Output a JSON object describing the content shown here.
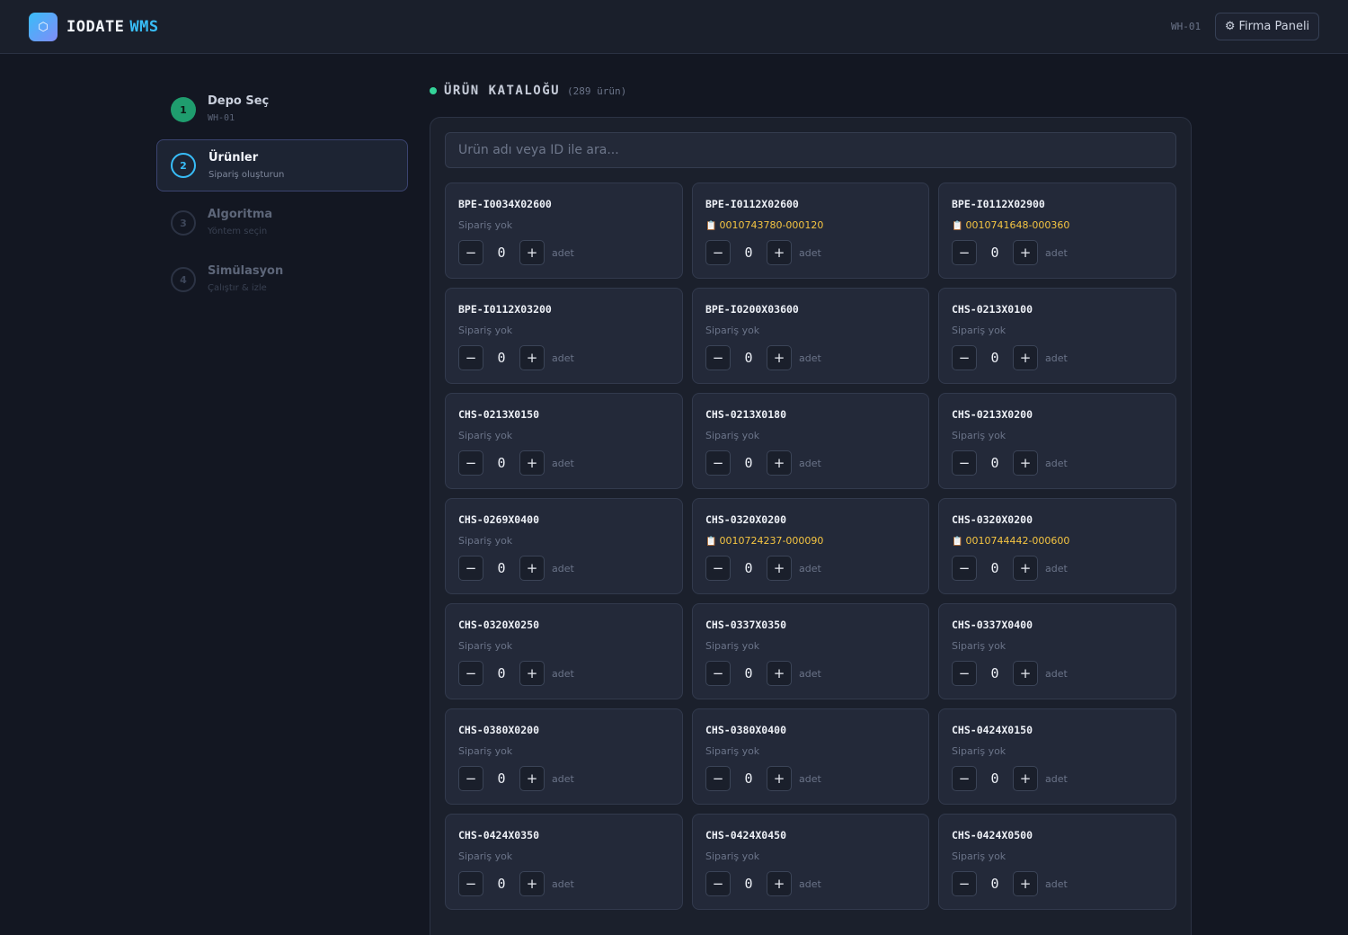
{
  "header": {
    "logo_icon": "hexagon-icon",
    "brand_primary": "IODATE",
    "brand_secondary": "WMS",
    "warehouse_code": "WH-01",
    "firma_button": "Firma Paneli",
    "firma_icon": "gear-icon"
  },
  "steps": [
    {
      "number": "1",
      "title": "Depo Seç",
      "subtitle": "WH-01",
      "state": "done"
    },
    {
      "number": "2",
      "title": "Ürünler",
      "subtitle": "Sipariş oluşturun",
      "state": "active"
    },
    {
      "number": "3",
      "title": "Algoritma",
      "subtitle": "Yöntem seçin",
      "state": "todo"
    },
    {
      "number": "4",
      "title": "Simülasyon",
      "subtitle": "Çalıştır & izle",
      "state": "todo"
    }
  ],
  "catalog": {
    "title": "ÜRÜN KATALOĞU",
    "count_label": "(289 ürün)",
    "search_placeholder": "Ürün adı veya ID ile ara...",
    "unit_label": "adet",
    "minus_label": "−",
    "plus_label": "+",
    "order_icon": "clipboard-icon",
    "products": [
      {
        "id": "BPE-I0034X02600",
        "order": "Sipariş yok",
        "has_order": false,
        "qty": "0"
      },
      {
        "id": "BPE-I0112X02600",
        "order": "0010743780-000120",
        "has_order": true,
        "qty": "0"
      },
      {
        "id": "BPE-I0112X02900",
        "order": "0010741648-000360",
        "has_order": true,
        "qty": "0"
      },
      {
        "id": "BPE-I0112X03200",
        "order": "Sipariş yok",
        "has_order": false,
        "qty": "0"
      },
      {
        "id": "BPE-I0200X03600",
        "order": "Sipariş yok",
        "has_order": false,
        "qty": "0"
      },
      {
        "id": "CHS-0213X0100",
        "order": "Sipariş yok",
        "has_order": false,
        "qty": "0"
      },
      {
        "id": "CHS-0213X0150",
        "order": "Sipariş yok",
        "has_order": false,
        "qty": "0"
      },
      {
        "id": "CHS-0213X0180",
        "order": "Sipariş yok",
        "has_order": false,
        "qty": "0"
      },
      {
        "id": "CHS-0213X0200",
        "order": "Sipariş yok",
        "has_order": false,
        "qty": "0"
      },
      {
        "id": "CHS-0269X0400",
        "order": "Sipariş yok",
        "has_order": false,
        "qty": "0"
      },
      {
        "id": "CHS-0320X0200",
        "order": "0010724237-000090",
        "has_order": true,
        "qty": "0"
      },
      {
        "id": "CHS-0320X0200",
        "order": "0010744442-000600",
        "has_order": true,
        "qty": "0"
      },
      {
        "id": "CHS-0320X0250",
        "order": "Sipariş yok",
        "has_order": false,
        "qty": "0"
      },
      {
        "id": "CHS-0337X0350",
        "order": "Sipariş yok",
        "has_order": false,
        "qty": "0"
      },
      {
        "id": "CHS-0337X0400",
        "order": "Sipariş yok",
        "has_order": false,
        "qty": "0"
      },
      {
        "id": "CHS-0380X0200",
        "order": "Sipariş yok",
        "has_order": false,
        "qty": "0"
      },
      {
        "id": "CHS-0380X0400",
        "order": "Sipariş yok",
        "has_order": false,
        "qty": "0"
      },
      {
        "id": "CHS-0424X0150",
        "order": "Sipariş yok",
        "has_order": false,
        "qty": "0"
      },
      {
        "id": "CHS-0424X0350",
        "order": "Sipariş yok",
        "has_order": false,
        "qty": "0"
      },
      {
        "id": "CHS-0424X0450",
        "order": "Sipariş yok",
        "has_order": false,
        "qty": "0"
      },
      {
        "id": "CHS-0424X0500",
        "order": "Sipariş yok",
        "has_order": false,
        "qty": "0"
      }
    ]
  }
}
